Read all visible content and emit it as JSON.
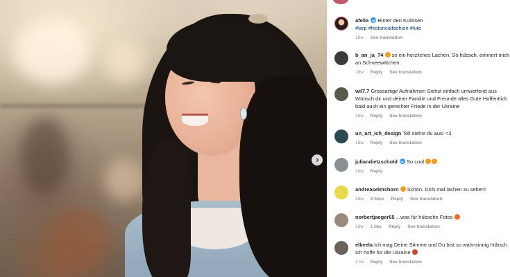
{
  "colors": {
    "link": "#00376b",
    "meta": "#8e8e8e",
    "verified": "#3897f0"
  },
  "post": {
    "username": "afelia",
    "caption": "Hinter den Kulissen",
    "hashtags": "#larp #historicalfashion #lute",
    "time": "18w",
    "see_translation": "See translation"
  },
  "comments": [
    {
      "username": "b_an_ja_74",
      "text": "so ein herzliches Lachen. So hübsch, erinnert mich an Schneewittchen.",
      "time": "18w",
      "reply": "Reply",
      "translate": "See translation",
      "verified": false,
      "emoji": "heart-eyes-face"
    },
    {
      "username": "wil7.7",
      "text": "Grossartige Aufnahmen Siehst einfach umwerfend aus Wünsch dir und deiner Familie und Freunde alles Gute Hoffentlich bald auch ein gerechter Friede in der Ukraine",
      "time": "18w",
      "reply": "Reply",
      "translate": "See translation",
      "verified": false
    },
    {
      "username": "un_art_ich_design",
      "text": "Toll siehst du aus! <3",
      "time": "18w",
      "reply": "Reply",
      "translate": "See translation",
      "verified": false
    },
    {
      "username": "juliandietzschold",
      "text": "So cool",
      "time": "18w",
      "reply": "Reply",
      "verified": true,
      "emoji": "heart-eyes-face-x2"
    },
    {
      "username": "andreaselmshorn",
      "text": "Schön. Dich mal lachen zu sehen!",
      "time": "18w",
      "likes": "2 likes",
      "reply": "Reply",
      "translate": "See translation",
      "verified": false,
      "emoji": "heart-eyes-face"
    },
    {
      "username": "norbertjaeger65",
      "text": "...was für hübsche Fotos",
      "time": "18w",
      "likes": "1 like",
      "reply": "Reply",
      "translate": "See translation",
      "verified": false,
      "emoji": "fire-icon"
    },
    {
      "username": "elkeela",
      "text": "Ich mag Deine Stimme und Du bist so wahnsinnig hübsch. Ich hoffe für die Ukraine",
      "time": "17w",
      "reply": "Reply",
      "translate": "See translation",
      "verified": false,
      "emoji": "heart-icon"
    }
  ]
}
